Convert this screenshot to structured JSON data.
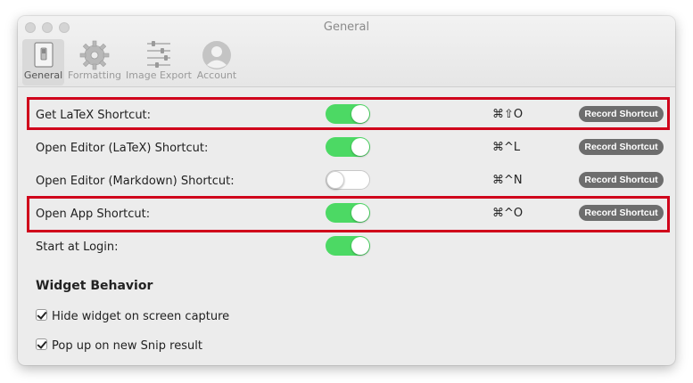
{
  "window": {
    "title": "General"
  },
  "toolbar": {
    "tabs": [
      {
        "label": "General",
        "icon": "general-switch-icon",
        "active": true
      },
      {
        "label": "Formatting",
        "icon": "gear-icon",
        "active": false
      },
      {
        "label": "Image Export",
        "icon": "sliders-icon",
        "active": false
      },
      {
        "label": "Account",
        "icon": "user-icon",
        "active": false
      }
    ]
  },
  "shortcuts": [
    {
      "label": "Get LaTeX Shortcut:",
      "enabled": true,
      "keys": "⌘⇧O",
      "button": "Record Shortcut",
      "highlighted": true
    },
    {
      "label": "Open Editor (LaTeX) Shortcut:",
      "enabled": true,
      "keys": "⌘^L",
      "button": "Record Shortcut",
      "highlighted": false
    },
    {
      "label": "Open Editor (Markdown) Shortcut:",
      "enabled": false,
      "keys": "⌘^N",
      "button": "Record Shortcut",
      "highlighted": false
    },
    {
      "label": "Open App Shortcut:",
      "enabled": true,
      "keys": "⌘^O",
      "button": "Record Shortcut",
      "highlighted": true
    }
  ],
  "start_at_login": {
    "label": "Start at Login:",
    "enabled": true
  },
  "widget_behavior": {
    "title": "Widget Behavior",
    "options": [
      {
        "label": "Hide widget on screen capture",
        "checked": true
      },
      {
        "label": "Pop up on new Snip result",
        "checked": true
      }
    ]
  },
  "colors": {
    "toggle_on": "#4cd964",
    "highlight": "#d0021b",
    "button_bg": "#6d6d6d"
  }
}
